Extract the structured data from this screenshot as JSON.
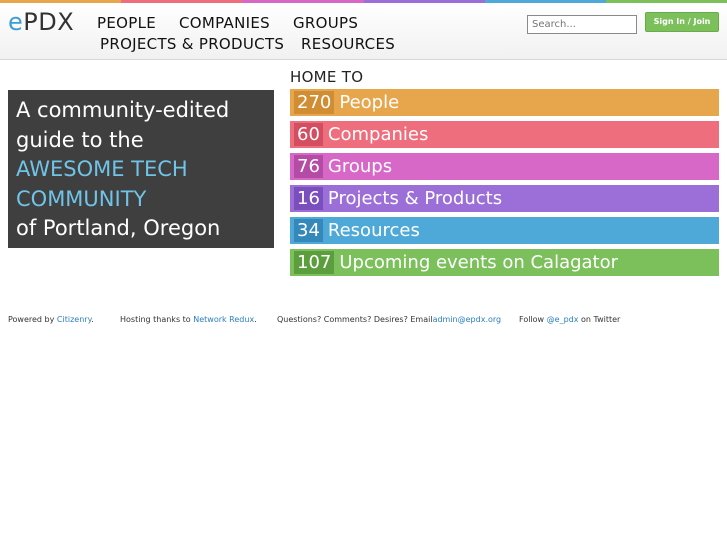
{
  "colors": {
    "rainbow": [
      "#e8a64c",
      "#ef6e7d",
      "#d768c8",
      "#9b6ed8",
      "#4ea9d9",
      "#7cc05c"
    ],
    "hero_bg": "#3f3f3f",
    "accent": "#6fc4e8",
    "signin": "#7cc05c"
  },
  "header": {
    "logo_e": "e",
    "logo_rest": "PDX",
    "nav": [
      "PEOPLE",
      "COMPANIES",
      "GROUPS",
      "PROJECTS & PRODUCTS",
      "RESOURCES"
    ],
    "search_placeholder": "Search...",
    "signin_label": "Sign In / Join"
  },
  "hero": {
    "lines": [
      "A community-edited",
      "guide to the",
      "AWESOME TECH",
      "COMMUNITY",
      "of Portland, Oregon"
    ]
  },
  "home_to": "HOME TO",
  "stats": [
    {
      "count": "270",
      "label": "People",
      "color": "#e8a64c",
      "count_bg": "#d08d33"
    },
    {
      "count": "60",
      "label": "Companies",
      "color": "#ef6e7d",
      "count_bg": "#d44e62"
    },
    {
      "count": "76",
      "label": "Groups",
      "color": "#d768c8",
      "count_bg": "#b44ca6"
    },
    {
      "count": "16",
      "label": "Projects & Products",
      "color": "#9b6ed8",
      "count_bg": "#7a4fbd"
    },
    {
      "count": "34",
      "label": "Resources",
      "color": "#4ea9d9",
      "count_bg": "#3488ba"
    },
    {
      "count": "107",
      "label": "Upcoming events on Calagator",
      "color": "#7cc05c",
      "count_bg": "#5c9e3e"
    }
  ],
  "footer": {
    "powered_by": "Powered by",
    "powered_link": "Citizenry",
    "powered_end": ".",
    "hosting": "Hosting thanks to",
    "hosting_link": "Network Redux",
    "hosting_end": ".",
    "questions": "Questions? Comments? Desires? Email",
    "email": "admin@epdx.org",
    "follow": "Follow",
    "twitter": "@e_pdx",
    "follow_end": "on Twitter"
  }
}
